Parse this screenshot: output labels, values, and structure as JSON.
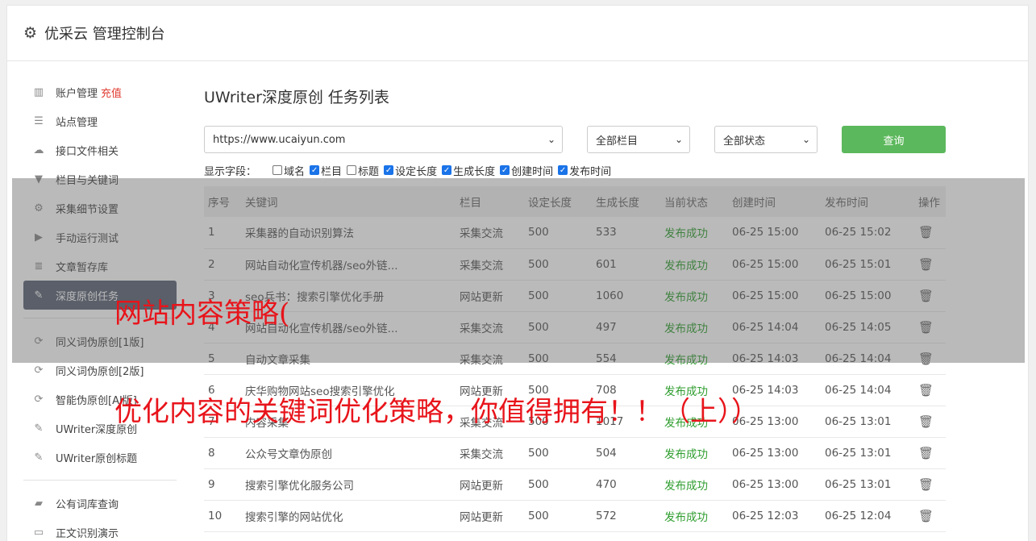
{
  "header": {
    "title": "优采云 管理控制台",
    "icon": "gear-icon"
  },
  "sidebar": {
    "items": [
      {
        "label": "账户管理",
        "badge": "充值",
        "icon": "bar-chart-icon"
      },
      {
        "label": "站点管理",
        "icon": "server-icon"
      },
      {
        "label": "接口文件相关",
        "icon": "cloud-upload-icon"
      },
      {
        "label": "栏目与关键词",
        "icon": "filter-icon"
      },
      {
        "label": "采集细节设置",
        "icon": "gears-icon"
      },
      {
        "label": "手动运行测试",
        "icon": "play-icon"
      },
      {
        "label": "文章暂存库",
        "icon": "database-icon"
      },
      {
        "label": "深度原创任务",
        "icon": "edit-icon"
      },
      {
        "label": "同义词伪原创[1版]",
        "icon": "refresh-icon"
      },
      {
        "label": "同义词伪原创[2版]",
        "icon": "refresh-icon"
      },
      {
        "label": "智能伪原创[AI版]",
        "icon": "refresh-icon"
      },
      {
        "label": "UWriter深度原创",
        "icon": "edit-icon"
      },
      {
        "label": "UWriter原创标题",
        "icon": "edit-icon"
      },
      {
        "label": "公有词库查询",
        "icon": "book-icon"
      },
      {
        "label": "正文识别演示",
        "icon": "monitor-icon"
      }
    ]
  },
  "main": {
    "title": "UWriter深度原创 任务列表",
    "site_select": "https://www.ucaiyun.com",
    "column_select": "全部栏目",
    "status_select": "全部状态",
    "query_button": "查询",
    "fields_label": "显示字段：",
    "fields": [
      {
        "label": "域名",
        "checked": false
      },
      {
        "label": "栏目",
        "checked": true
      },
      {
        "label": "标题",
        "checked": false
      },
      {
        "label": "设定长度",
        "checked": true
      },
      {
        "label": "生成长度",
        "checked": true
      },
      {
        "label": "创建时间",
        "checked": true
      },
      {
        "label": "发布时间",
        "checked": true
      }
    ],
    "table": {
      "headers": [
        "序号",
        "关键词",
        "栏目",
        "设定长度",
        "生成长度",
        "当前状态",
        "创建时间",
        "发布时间",
        "操作"
      ],
      "rows": [
        [
          "1",
          "采集器的自动识别算法",
          "采集交流",
          "500",
          "533",
          "发布成功",
          "06-25 15:00",
          "06-25 15:02"
        ],
        [
          "2",
          "网站自动化宣传机器/seo外链...",
          "采集交流",
          "500",
          "601",
          "发布成功",
          "06-25 15:00",
          "06-25 15:01"
        ],
        [
          "3",
          "seo兵书：搜索引擎优化手册",
          "网站更新",
          "500",
          "1060",
          "发布成功",
          "06-25 15:00",
          "06-25 15:00"
        ],
        [
          "4",
          "网站自动化宣传机器/seo外链...",
          "采集交流",
          "500",
          "497",
          "发布成功",
          "06-25 14:04",
          "06-25 14:05"
        ],
        [
          "5",
          "自动文章采集",
          "采集交流",
          "500",
          "554",
          "发布成功",
          "06-25 14:03",
          "06-25 14:04"
        ],
        [
          "6",
          "庆华购物网站seo搜索引擎优化",
          "网站更新",
          "500",
          "708",
          "发布成功",
          "06-25 14:03",
          "06-25 14:04"
        ],
        [
          "7",
          "内容采集",
          "采集交流",
          "500",
          "1017",
          "发布成功",
          "06-25 13:00",
          "06-25 13:01"
        ],
        [
          "8",
          "公众号文章伪原创",
          "采集交流",
          "500",
          "504",
          "发布成功",
          "06-25 13:00",
          "06-25 13:01"
        ],
        [
          "9",
          "搜索引擎优化服务公司",
          "网站更新",
          "500",
          "470",
          "发布成功",
          "06-25 13:00",
          "06-25 13:01"
        ],
        [
          "10",
          "搜索引擎的网站优化",
          "网站更新",
          "500",
          "572",
          "发布成功",
          "06-25 12:03",
          "06-25 12:04"
        ]
      ]
    }
  },
  "overlay_text": {
    "line1": "网站内容策略(",
    "line2": "优化内容的关键词优化策略，你值得拥有！！（上））"
  },
  "colors": {
    "accent_green": "#5cb85c",
    "active_nav": "#5a6274",
    "success": "#2e9d2e",
    "overlay_red": "#e8141b"
  }
}
